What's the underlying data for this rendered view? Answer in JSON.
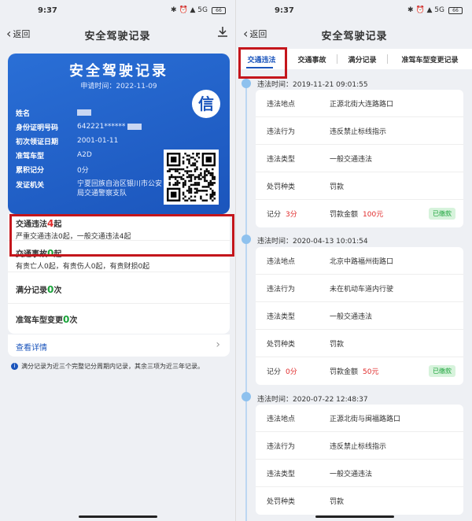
{
  "left": {
    "status": {
      "time": "9:37",
      "icons_text": "✱ ⏰ ▲ 5G",
      "battery": "66"
    },
    "nav": {
      "back": "返回",
      "title": "安全驾驶记录"
    },
    "card": {
      "title": "安全驾驶记录",
      "apply_date": "申请时间：2022-11-09",
      "seal": "信",
      "rows": [
        {
          "label": "姓名",
          "value": ""
        },
        {
          "label": "身份证明号码",
          "value": "642221******"
        },
        {
          "label": "初次领证日期",
          "value": "2001-01-11"
        },
        {
          "label": "准驾车型",
          "value": "A2D"
        },
        {
          "label": "累积记分",
          "value": "0分"
        }
      ],
      "issuer_label": "发证机关",
      "issuer": "宁夏回族自治区银川市公安局交通警察支队"
    },
    "summary": {
      "violation": {
        "label": "交通违法",
        "count": "4",
        "unit": "起",
        "sub": "严重交通违法0起，一般交通违法4起"
      },
      "accident": {
        "label": "交通事故",
        "count": "0",
        "unit": "起",
        "sub": "有责亡人0起，有责伤人0起，有责财损0起"
      },
      "full_score": {
        "label": "满分记录",
        "count": "0",
        "unit": "次"
      },
      "vehicle_change": {
        "label": "准驾车型变更",
        "count": "0",
        "unit": "次"
      },
      "detail": "查看详情"
    },
    "note": "满分记录为近三个完整记分周期内记录，其余三项为近三年记录。"
  },
  "right": {
    "status": {
      "time": "9:37",
      "icons_text": "✱ ⏰ ▲ 5G",
      "battery": "66"
    },
    "nav": {
      "back": "返回",
      "title": "安全驾驶记录"
    },
    "tabs": [
      "交通违法",
      "交通事故",
      "满分记录",
      "准驾车型变更记录"
    ],
    "records": [
      {
        "time": "违法时间：2019-11-21 09:01:55",
        "rows": [
          {
            "k": "违法地点",
            "v": "正源北街大连路路口"
          },
          {
            "k": "违法行为",
            "v": "违反禁止标线指示"
          },
          {
            "k": "违法类型",
            "v": "一般交通违法"
          },
          {
            "k": "处罚种类",
            "v": "罚款"
          }
        ],
        "score_label": "记分",
        "score": "3分",
        "fine_label": "罚款金额",
        "fine": "100元",
        "status": "已缴款"
      },
      {
        "time": "违法时间：2020-04-13 10:01:54",
        "rows": [
          {
            "k": "违法地点",
            "v": "北京中路福州街路口"
          },
          {
            "k": "违法行为",
            "v": "未在机动车道内行驶"
          },
          {
            "k": "违法类型",
            "v": "一般交通违法"
          },
          {
            "k": "处罚种类",
            "v": "罚款"
          }
        ],
        "score_label": "记分",
        "score": "0分",
        "fine_label": "罚款金额",
        "fine": "50元",
        "status": "已缴款"
      },
      {
        "time": "违法时间：2020-07-22 12:48:37",
        "rows": [
          {
            "k": "违法地点",
            "v": "正源北街与闽福路路口"
          },
          {
            "k": "违法行为",
            "v": "违反禁止标线指示"
          },
          {
            "k": "违法类型",
            "v": "一般交通违法"
          },
          {
            "k": "处罚种类",
            "v": "罚款"
          }
        ]
      }
    ]
  }
}
